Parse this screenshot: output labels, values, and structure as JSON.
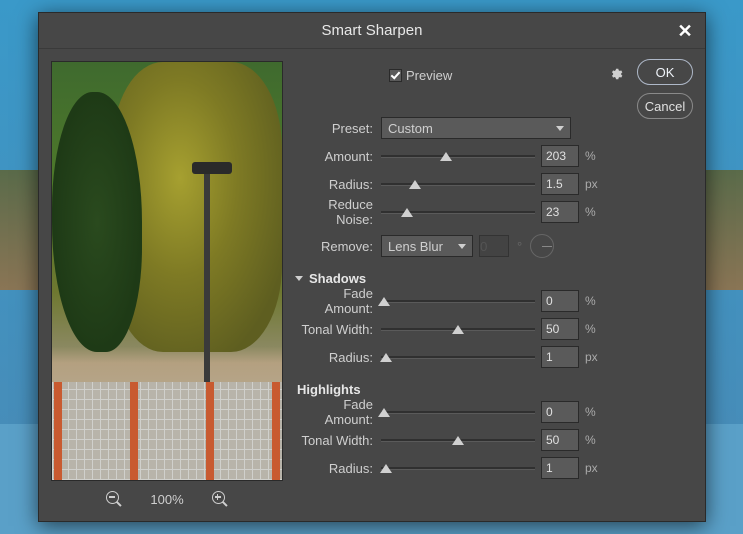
{
  "dialog": {
    "title": "Smart Sharpen",
    "close_symbol": "✕"
  },
  "preview": {
    "checkbox_checked": true,
    "label": "Preview"
  },
  "buttons": {
    "ok": "OK",
    "cancel": "Cancel"
  },
  "preset": {
    "label": "Preset:",
    "value": "Custom"
  },
  "controls": {
    "amount": {
      "label": "Amount:",
      "value": "203",
      "unit": "%",
      "pos": 42
    },
    "radius": {
      "label": "Radius:",
      "value": "1.5",
      "unit": "px",
      "pos": 22
    },
    "reduce_noise": {
      "label": "Reduce Noise:",
      "value": "23",
      "unit": "%",
      "pos": 17
    }
  },
  "remove": {
    "label": "Remove:",
    "value": "Lens Blur",
    "angle_value": "0",
    "degree_symbol": "°"
  },
  "shadows": {
    "header": "Shadows",
    "fade_amount": {
      "label": "Fade Amount:",
      "value": "0",
      "unit": "%",
      "pos": 2
    },
    "tonal_width": {
      "label": "Tonal Width:",
      "value": "50",
      "unit": "%",
      "pos": 50
    },
    "radius": {
      "label": "Radius:",
      "value": "1",
      "unit": "px",
      "pos": 3
    }
  },
  "highlights": {
    "header": "Highlights",
    "fade_amount": {
      "label": "Fade Amount:",
      "value": "0",
      "unit": "%",
      "pos": 2
    },
    "tonal_width": {
      "label": "Tonal Width:",
      "value": "50",
      "unit": "%",
      "pos": 50
    },
    "radius": {
      "label": "Radius:",
      "value": "1",
      "unit": "px",
      "pos": 3
    }
  },
  "zoom": {
    "level": "100%"
  }
}
